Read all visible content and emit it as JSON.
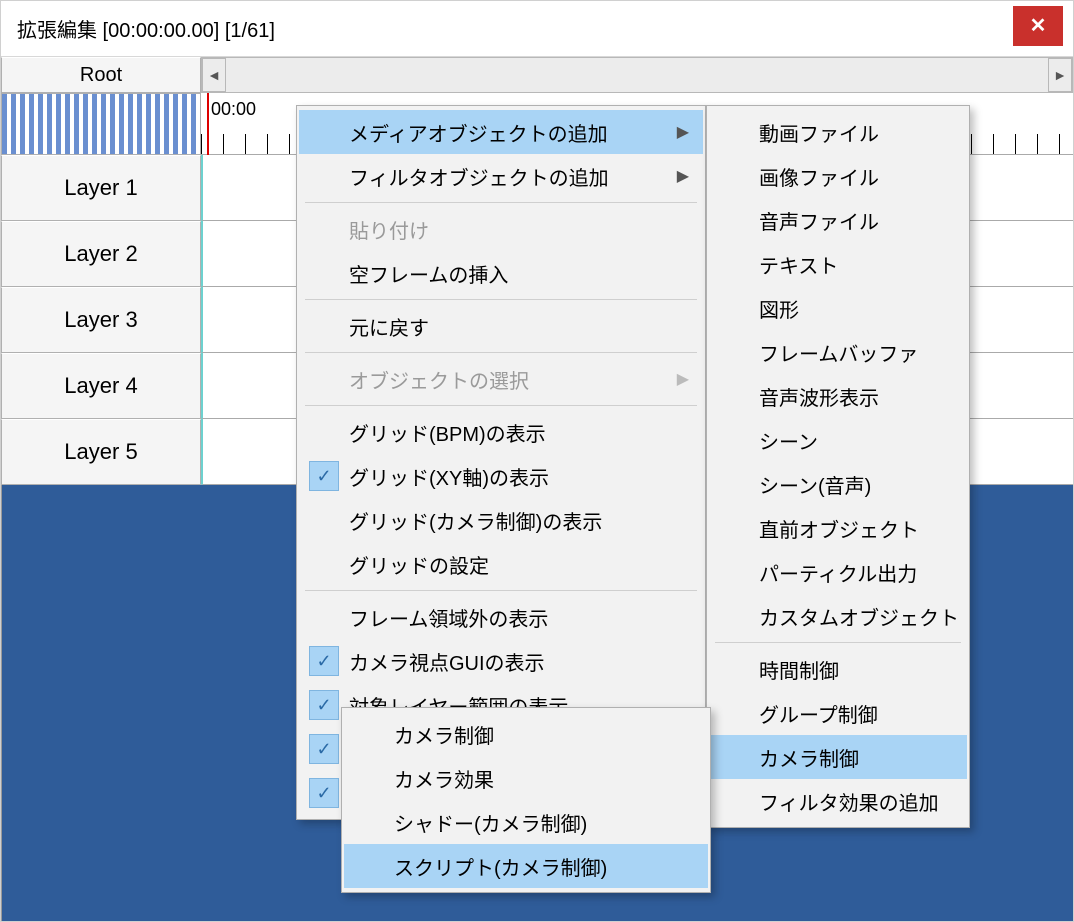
{
  "window": {
    "title": "拡張編集 [00:00:00.00] [1/61]"
  },
  "root_label": "Root",
  "time_ruler_label": "00:00",
  "layers": [
    "Layer 1",
    "Layer 2",
    "Layer 3",
    "Layer 4",
    "Layer 5"
  ],
  "main_menu": {
    "items": [
      {
        "label": "メディアオブジェクトの追加",
        "sub": true,
        "hl": true
      },
      {
        "label": "フィルタオブジェクトの追加",
        "sub": true
      },
      {
        "sep": true
      },
      {
        "label": "貼り付け",
        "disabled": true
      },
      {
        "label": "空フレームの挿入"
      },
      {
        "sep": true
      },
      {
        "label": "元に戻す"
      },
      {
        "sep": true
      },
      {
        "label": "オブジェクトの選択",
        "sub": true,
        "disabled": true
      },
      {
        "sep": true
      },
      {
        "label": "グリッド(BPM)の表示"
      },
      {
        "label": "グリッド(XY軸)の表示",
        "check": true
      },
      {
        "label": "グリッド(カメラ制御)の表示"
      },
      {
        "label": "グリッドの設定"
      },
      {
        "sep": true
      },
      {
        "label": "フレーム領域外の表示"
      },
      {
        "label": "カメラ視点GUIの表示",
        "check": true
      },
      {
        "label": "対象レイヤー範囲の表示",
        "check": true
      },
      {
        "label": "",
        "check": true
      },
      {
        "label": "",
        "check": true
      }
    ]
  },
  "sub_menu1": {
    "items": [
      {
        "label": "動画ファイル"
      },
      {
        "label": "画像ファイル"
      },
      {
        "label": "音声ファイル"
      },
      {
        "label": "テキスト"
      },
      {
        "label": "図形"
      },
      {
        "label": "フレームバッファ"
      },
      {
        "label": "音声波形表示"
      },
      {
        "label": "シーン"
      },
      {
        "label": "シーン(音声)"
      },
      {
        "label": "直前オブジェクト"
      },
      {
        "label": "パーティクル出力"
      },
      {
        "label": "カスタムオブジェクト"
      },
      {
        "sep": true
      },
      {
        "label": "時間制御"
      },
      {
        "label": "グループ制御"
      },
      {
        "label": "カメラ制御",
        "hl": true
      },
      {
        "label": "フィルタ効果の追加"
      }
    ]
  },
  "sub_menu2": {
    "items": [
      {
        "label": "カメラ制御"
      },
      {
        "label": "カメラ効果"
      },
      {
        "label": "シャドー(カメラ制御)"
      },
      {
        "label": "スクリプト(カメラ制御)",
        "hl": true
      }
    ]
  }
}
